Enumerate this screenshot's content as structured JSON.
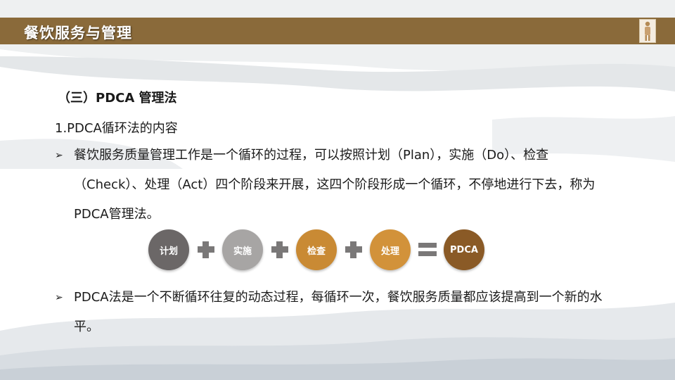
{
  "header": {
    "title": "餐饮服务与管理",
    "bar_color": "#8a6a3a"
  },
  "section": {
    "title": "（三）PDCA 管理法",
    "subtitle": "1.PDCA循环法的内容"
  },
  "bullets": [
    "餐饮服务质量管理工作是一个循环的过程，可以按照计划（Plan），实施（Do）、检查（Check）、处理（Act）四个阶段来开展，这四个阶段形成一个循环，不停地进行下去，称为 PDCA管理法。",
    "PDCA法是一个不断循环往复的动态过程，每循环一次，餐饮服务质量都应该提高到一个新的水平。"
  ],
  "flow": {
    "steps": [
      {
        "label": "计划",
        "color": "#6b6767"
      },
      {
        "label": "实施",
        "color": "#a7a5a4"
      },
      {
        "label": "检查",
        "color": "#c98a34"
      },
      {
        "label": "处理",
        "color": "#d2923a"
      },
      {
        "label": "PDCA",
        "color": "#8a5a26"
      }
    ],
    "operators": [
      "plus",
      "plus",
      "plus",
      "equals"
    ]
  },
  "icons": {
    "bullet": "arrow-bullet-icon"
  }
}
